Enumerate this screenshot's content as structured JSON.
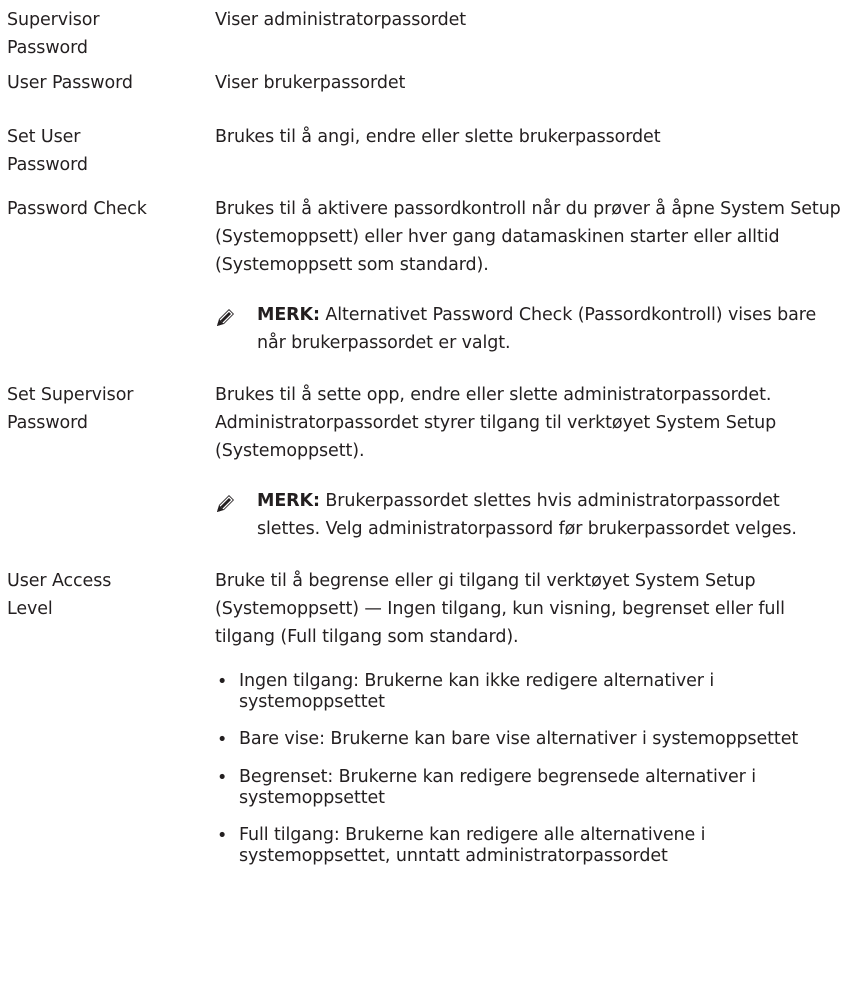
{
  "rows": [
    {
      "term": "Supervisor Password",
      "desc": "Viser administratorpassordet"
    },
    {
      "term": "User Password",
      "desc": "Viser brukerpassordet"
    },
    {
      "term": "Set User Password",
      "desc": "Brukes til å angi, endre eller slette brukerpassordet"
    },
    {
      "term": "Password Check",
      "desc": "Brukes til å aktivere passordkontroll når du prøver å åpne System Setup (Systemoppsett) eller hver gang datamaskinen starter eller alltid (Systemoppsett som standard)."
    },
    {
      "term": "Set Supervisor Password",
      "desc": "Brukes til å sette opp, endre eller slette administratorpassordet. Administratorpassordet styrer tilgang til verktøyet System Setup (Systemoppsett)."
    },
    {
      "term": "User Access Level",
      "desc": "Bruke til å begrense eller gi tilgang til verktøyet System Setup (Systemoppsett) — Ingen tilgang, kun visning, begrenset eller full tilgang (Full tilgang som standard)."
    }
  ],
  "notes": [
    {
      "label": "MERK:",
      "text": " Alternativet Password Check (Passordkontroll) vises bare når brukerpassordet er valgt."
    },
    {
      "label": "MERK:",
      "text": " Brukerpassordet slettes hvis administratorpassordet slettes. Velg administratorpassord før brukerpassordet velges."
    }
  ],
  "bullets": [
    "Ingen tilgang: Brukerne kan ikke redigere alternativer i systemoppsettet",
    "Bare vise: Brukerne kan bare vise alternativer i systemoppsettet",
    "Begrenset: Brukerne kan redigere begrensede alternativer i systemoppsettet",
    "Full tilgang: Brukerne kan redigere alle alternativene i systemoppsettet, unntatt administratorpassordet"
  ],
  "icons": {
    "note": "pencil-note-icon"
  }
}
